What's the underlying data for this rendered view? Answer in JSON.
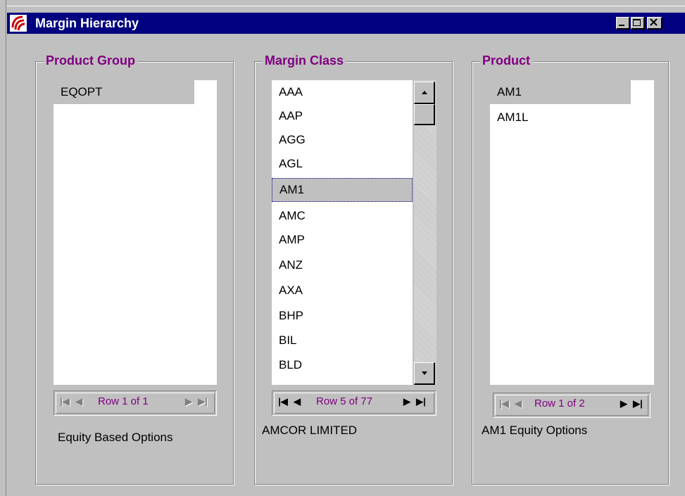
{
  "window": {
    "title": "Margin Hierarchy"
  },
  "groups": {
    "product_group": {
      "label": "Product Group",
      "items": [
        "EQOPT"
      ],
      "nav_text": "Row 1 of 1",
      "description": "Equity Based Options"
    },
    "margin_class": {
      "label": "Margin Class",
      "items": [
        "AAA",
        "AAP",
        "AGG",
        "AGL",
        "AM1",
        "AMC",
        "AMP",
        "ANZ",
        "AXA",
        "BHP",
        "BIL",
        "BLD"
      ],
      "selected_index": 4,
      "nav_text": "Row 5 of 77",
      "description": "AMCOR LIMITED"
    },
    "product": {
      "label": "Product",
      "items": [
        "AM1",
        "AM1L"
      ],
      "nav_text": "Row 1 of 2",
      "description": "AM1 Equity Options"
    }
  },
  "colors": {
    "titlebar": "#000080",
    "label": "#800080",
    "face": "#c0c0c0"
  },
  "icons": {
    "app": "app-logo-icon",
    "minimize": "minimize-icon",
    "maximize": "maximize-icon",
    "close": "close-icon"
  }
}
